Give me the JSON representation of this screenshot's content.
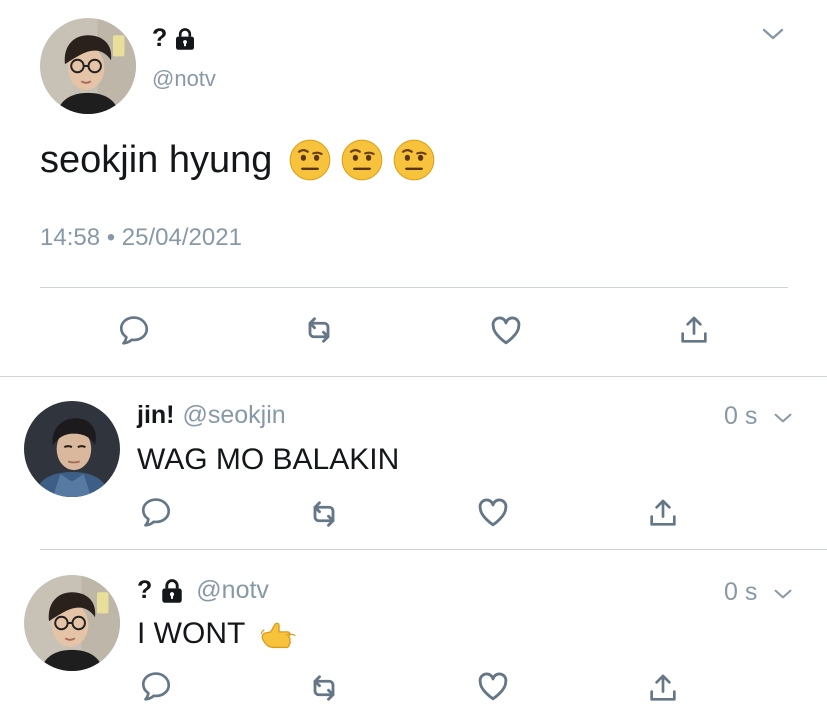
{
  "main_tweet": {
    "display_name": "?",
    "handle": "@notv",
    "text": "seokjin hyung",
    "emoji_count": 3,
    "timestamp": "14:58 • 25/04/2021",
    "icons": [
      "reply-icon",
      "retweet-icon",
      "like-icon",
      "share-icon"
    ]
  },
  "replies": [
    {
      "display_name": "jin!",
      "handle": "@seokjin",
      "time": "0 s",
      "text": "WAG MO BALAKIN"
    },
    {
      "display_name": "?",
      "handle": "@notv",
      "time": "0 s",
      "text": "I WONT"
    }
  ],
  "colors": {
    "text": "#14171a",
    "muted": "#8899a6",
    "icon": "#657786",
    "divider": "#cfd4d9"
  }
}
